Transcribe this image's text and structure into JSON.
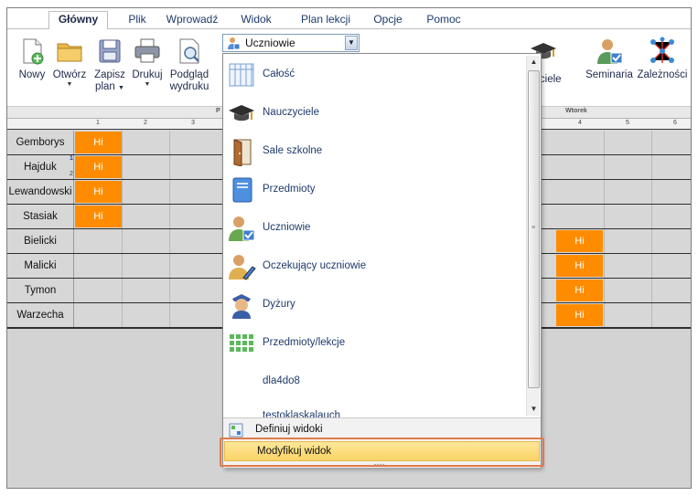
{
  "tabs": [
    "Główny",
    "Plik",
    "Wprowadź",
    "Widok",
    "Plan lekcji",
    "Opcje",
    "Pomoc"
  ],
  "active_tab": "Główny",
  "ribbon": {
    "new": "Nowy",
    "open": "Otwórz",
    "save": "Zapisz",
    "save2": "plan",
    "print": "Drukuj",
    "preview": "Podgląd",
    "preview2": "wydruku",
    "combo_value": "Uczniowie",
    "teachers_partial": "zyciele",
    "seminars": "Seminaria",
    "dependencies": "Zależności"
  },
  "grid": {
    "day_left": "P",
    "day_right": "Wtorek",
    "col_left": [
      "1",
      "2",
      "3"
    ],
    "col_right": [
      "4",
      "5",
      "6"
    ],
    "rows": [
      {
        "name": "Gemborys",
        "hi_left": "Hi",
        "hi_right": ""
      },
      {
        "name": "Hajduk",
        "hi_left": "Hi",
        "hi_right": "",
        "mark1": "1",
        "mark2": "2"
      },
      {
        "name": "Lewandowski",
        "hi_left": "Hi",
        "hi_right": ""
      },
      {
        "name": "Stasiak",
        "hi_left": "Hi",
        "hi_right": ""
      },
      {
        "name": "Bielicki",
        "hi_left": "",
        "hi_right": "Hi"
      },
      {
        "name": "Malicki",
        "hi_left": "",
        "hi_right": "Hi"
      },
      {
        "name": "Tymon",
        "hi_left": "",
        "hi_right": "Hi"
      },
      {
        "name": "Warzecha",
        "hi_left": "",
        "hi_right": "Hi"
      }
    ]
  },
  "dropdown": {
    "items": [
      {
        "label": "Całość",
        "icon": "table-icon"
      },
      {
        "label": "Nauczyciele",
        "icon": "graduation-cap-icon"
      },
      {
        "label": "Sale szkolne",
        "icon": "door-icon"
      },
      {
        "label": "Przedmioty",
        "icon": "book-icon"
      },
      {
        "label": "Uczniowie",
        "icon": "student-icon"
      },
      {
        "label": "Oczekujący uczniowie",
        "icon": "student-pencil-icon"
      },
      {
        "label": "Dyżury",
        "icon": "police-officer-icon"
      },
      {
        "label": "Przedmioty/lekcje",
        "icon": "green-grid-icon"
      },
      {
        "label": "dla4do8",
        "icon": ""
      },
      {
        "label": "testoklaskalauch",
        "icon": ""
      }
    ],
    "define_views": "Definiuj widoki",
    "modify_view": "Modyfikuj widok"
  }
}
